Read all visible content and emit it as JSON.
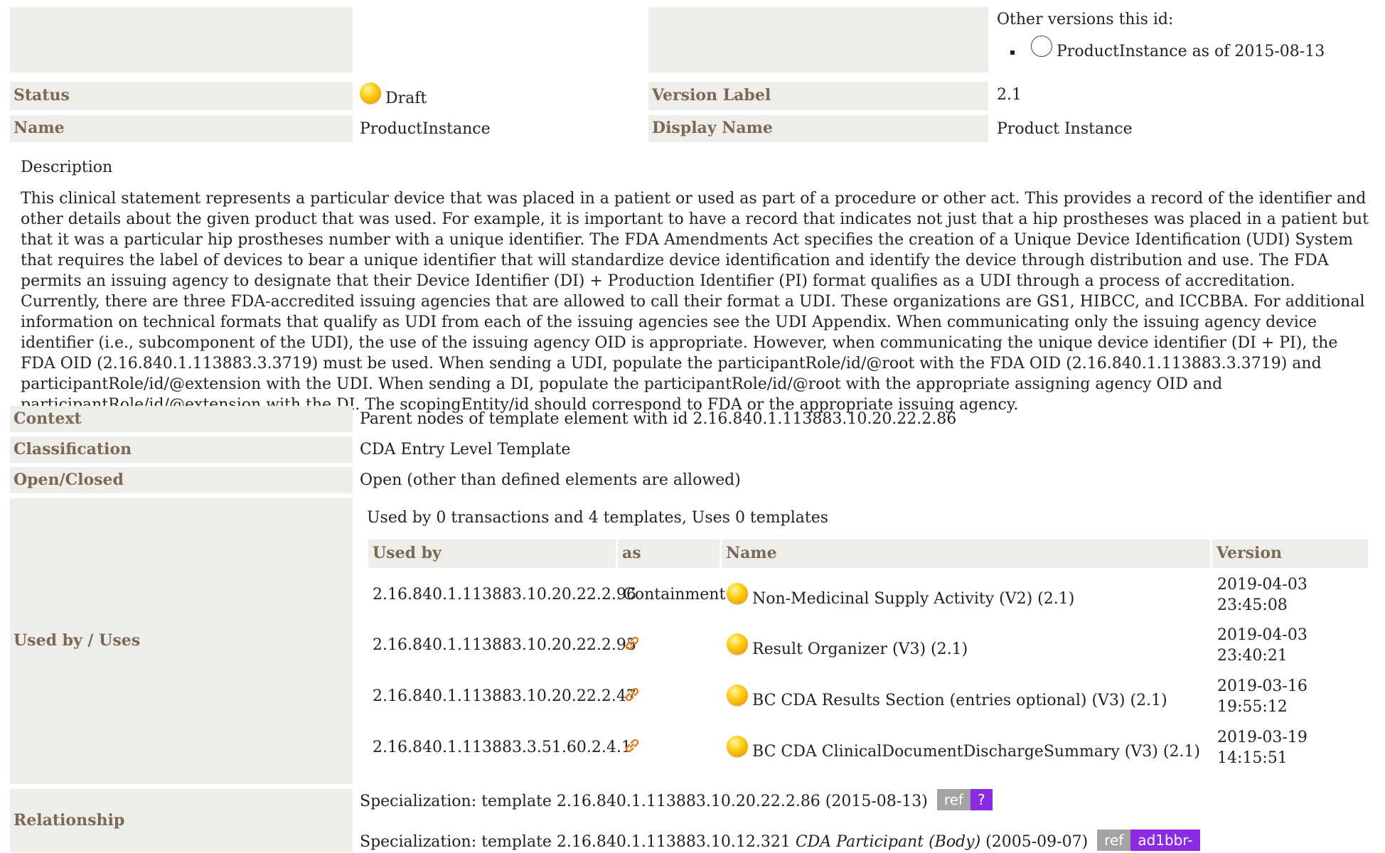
{
  "other_versions": {
    "label": "Other versions this id:",
    "items": [
      "ProductInstance as of 2015-08-13"
    ]
  },
  "status": {
    "label": "Status",
    "value": "Draft"
  },
  "version_label": {
    "label": "Version Label",
    "value": "2.1"
  },
  "name": {
    "label": "Name",
    "value": "ProductInstance"
  },
  "display_name": {
    "label": "Display Name",
    "value": "Product Instance"
  },
  "description": {
    "label": "Description",
    "text": "This clinical statement represents a particular device that was placed in a patient or used as part of a procedure or other act. This provides a record of the identifier and other details about the given product that was used. For example, it is important to have a record that indicates not just that a hip prostheses was placed in a patient but that it was a particular hip prostheses number with a unique identifier. The FDA Amendments Act specifies the creation of a Unique Device Identification (UDI) System that requires the label of devices to bear a unique identifier that will standardize device identification and identify the device through distribution and use. The FDA permits an issuing agency to designate that their Device Identifier (DI) + Production Identifier (PI) format qualifies as a UDI through a process of accreditation. Currently, there are three FDA-accredited issuing agencies that are allowed to call their format a UDI. These organizations are GS1, HIBCC, and ICCBBA. For additional information on technical formats that qualify as UDI from each of the issuing agencies see the UDI Appendix. When communicating only the issuing agency device identifier (i.e., subcomponent of the UDI), the use of the issuing agency OID is appropriate. However, when communicating the unique device identifier (DI + PI), the FDA OID (2.16.840.1.113883.3.3719) must be used. When sending a UDI, populate the participantRole/id/@root with the FDA OID (2.16.840.1.113883.3.3719) and participantRole/id/@extension with the UDI. When sending a DI, populate the participantRole/id/@root with the appropriate assigning agency OID and participantRole/id/@extension with the DI. The scopingEntity/id should correspond to FDA or the appropriate issuing agency."
  },
  "context": {
    "label": "Context",
    "value": "Parent nodes of template element with id 2.16.840.1.113883.10.20.22.2.86"
  },
  "classification": {
    "label": "Classification",
    "value": "CDA Entry Level Template"
  },
  "open_closed": {
    "label": "Open/Closed",
    "value": "Open (other than defined elements are allowed)"
  },
  "used_by": {
    "label": "Used by / Uses",
    "summary": "Used by 0 transactions and 4 templates, Uses 0 templates",
    "columns": [
      "Used by",
      "as",
      "Name",
      "Version"
    ],
    "rows": [
      {
        "id": "2.16.840.1.113883.10.20.22.2.96",
        "as": "Containment",
        "name": "Non-Medicinal Supply Activity (V2) (2.1)",
        "date": "2019-04-03",
        "time": "23:45:08"
      },
      {
        "id": "2.16.840.1.113883.10.20.22.2.95",
        "as": "",
        "name": "Result Organizer (V3) (2.1)",
        "date": "2019-04-03",
        "time": "23:40:21"
      },
      {
        "id": "2.16.840.1.113883.10.20.22.2.47",
        "as": "",
        "name": "BC CDA Results Section (entries optional) (V3) (2.1)",
        "date": "2019-03-16",
        "time": "19:55:12"
      },
      {
        "id": "2.16.840.1.113883.3.51.60.2.4.1",
        "as": "",
        "name": "BC CDA ClinicalDocumentDischargeSummary (V3) (2.1)",
        "date": "2019-03-19",
        "time": "14:15:51"
      }
    ]
  },
  "relationship": {
    "label": "Relationship",
    "items": [
      {
        "prefix": "Specialization: template 2.16.840.1.113883.10.20.22.2.86 (2015-08-13)",
        "italic": "",
        "suffix": "",
        "ref": "ref",
        "badge": "?"
      },
      {
        "prefix": "Specialization: template 2.16.840.1.113883.10.12.321 ",
        "italic": "CDA Participant (Body)",
        "suffix": " (2005-09-07)",
        "ref": "ref",
        "badge": "ad1bbr-"
      }
    ]
  },
  "colors": {
    "label_bg": "#efedea",
    "label_text": "#7a6a55",
    "badge_ref": "#a3a3a3",
    "badge_id": "#8a2be2",
    "status_draft": "#ffd21f"
  }
}
